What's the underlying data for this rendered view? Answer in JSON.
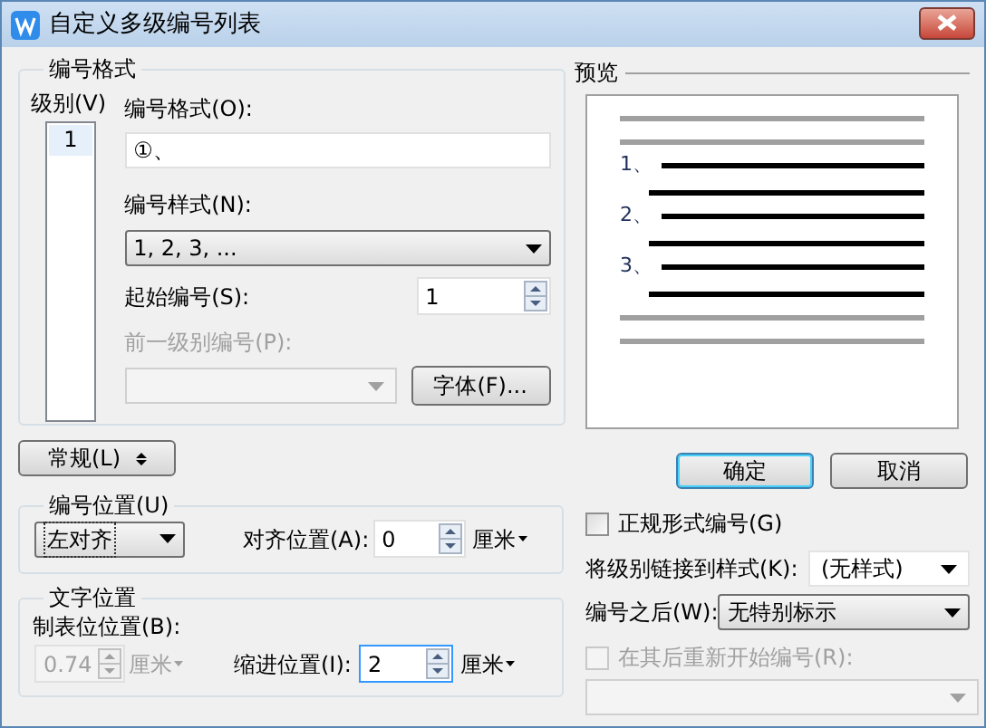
{
  "window": {
    "title": "自定义多级编号列表"
  },
  "number_format": {
    "title": "编号格式",
    "level_label": "级别(V)",
    "levels": [
      {
        "label": "1",
        "selected": true
      }
    ],
    "format_label": "编号格式(O):",
    "format_value": "①、",
    "style_label": "编号样式(N):",
    "style_value": "1, 2, 3, ...",
    "start_label": "起始编号(S):",
    "start_value": "1",
    "previous_label": "前一级别编号(P):",
    "previous_disabled": true,
    "font_button": "字体(F)..."
  },
  "preview": {
    "title": "预览",
    "numbers": [
      "1、",
      "2、",
      "3、"
    ]
  },
  "general_button": "常规(L)",
  "buttons": [
    {
      "label": "确定",
      "default": true
    },
    {
      "label": "取消",
      "default": false
    }
  ],
  "number_position": {
    "title": "编号位置(U)",
    "alignment": "左对齐",
    "align_at_label": "对齐位置(A):",
    "align_at_value": "0",
    "unit": "厘米"
  },
  "text_position": {
    "title": "文字位置",
    "tab_label": "制表位位置(B):",
    "tab_value": "0.74",
    "tab_disabled": true,
    "tab_unit": "厘米",
    "indent_label": "缩进位置(I):",
    "indent_value": "2",
    "indent_unit": "厘米"
  },
  "options": {
    "legal_label": "正规形式编号(G)",
    "legal_checked": false,
    "link_label": "将级别链接到样式(K):",
    "link_value": "(无样式)",
    "after_label": "编号之后(W):",
    "after_value": "无特别标示",
    "restart_label": "在其后重新开始编号(R):",
    "restart_checked": false,
    "restart_disabled": true
  }
}
